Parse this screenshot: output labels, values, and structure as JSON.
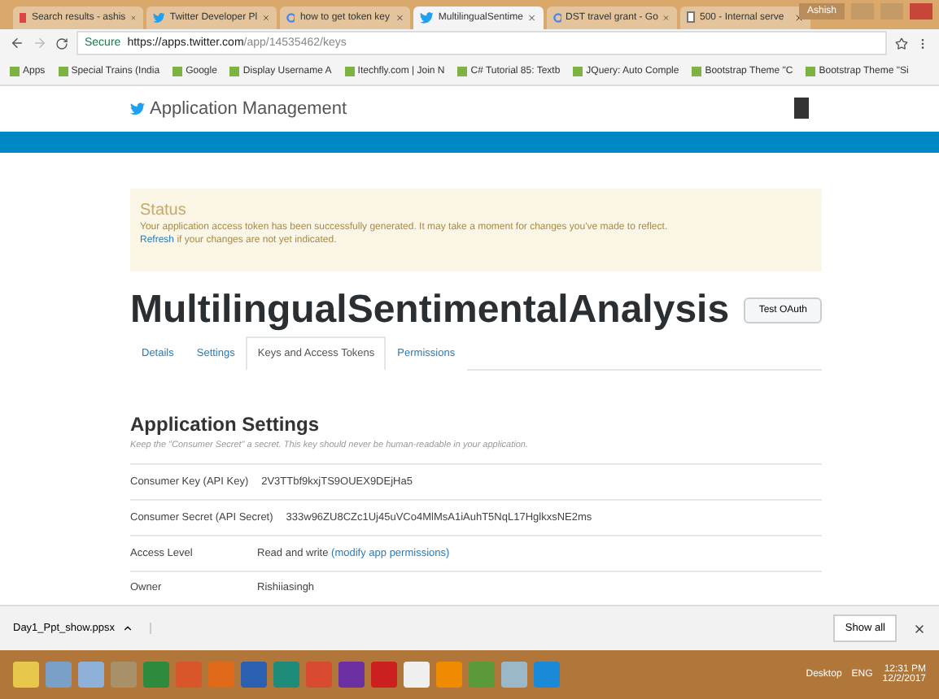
{
  "browser": {
    "tabs": [
      {
        "title": "Search results - ashis",
        "kind": "mail",
        "selected": false
      },
      {
        "title": "Twitter Developer Pl",
        "kind": "bird",
        "selected": false
      },
      {
        "title": "how to get token key",
        "kind": "search",
        "selected": false
      },
      {
        "title": "MultilingualSentime",
        "kind": "bird",
        "selected": true
      },
      {
        "title": "DST travel grant - Go",
        "kind": "search",
        "selected": false
      },
      {
        "title": "500 - Internal serve",
        "kind": "page",
        "selected": false
      }
    ],
    "user": "Ashish",
    "address": {
      "secure_label": "Secure",
      "host": "https://apps.twitter.com",
      "path": "/app/14535462/keys"
    },
    "bookmarks": [
      "Apps",
      "Special Trains (India",
      "Google",
      "Display Username A",
      "Itechfly.com | Join N",
      "C# Tutorial 85: Textb",
      "JQuery: Auto Comple",
      "Bootstrap Theme \"C",
      "Bootstrap Theme \"Si"
    ]
  },
  "header": {
    "title": "Application Management"
  },
  "status": {
    "heading": "Status",
    "message": "Your application access token has been successfully generated. It may take a moment for changes you've made to reflect.",
    "refresh_link": "Refresh",
    "refresh_rest": "if your changes are not yet indicated."
  },
  "app": {
    "name": "MultilingualSentimentalAnalysis",
    "test_button": "Test OAuth",
    "nav": [
      {
        "label": "Details",
        "selected": false
      },
      {
        "label": "Settings",
        "selected": false
      },
      {
        "label": "Keys and Access Tokens",
        "selected": true
      },
      {
        "label": "Permissions",
        "selected": false
      }
    ]
  },
  "settings": {
    "heading": "Application Settings",
    "note": "Keep the \"Consumer Secret\" a secret. This key should never be human-readable in your application.",
    "rows": [
      {
        "label": "Consumer Key (API Key)",
        "value": "2V3TTbf9kxjTS9OUEX9DEjHa5"
      },
      {
        "label": "Consumer Secret (API Secret)",
        "value": "333w96ZU8CZc1Uj45uVCo4MlMsA1iAuhT5NqL17HglkxsNE2ms"
      },
      {
        "label": "Access Level",
        "value": "Read and write",
        "link": "(modify app permissions)"
      },
      {
        "label": "Owner",
        "value": "Rishiiasingh"
      }
    ]
  },
  "downloads": {
    "file": "Day1_Ppt_show.ppsx",
    "show_all": "Show all"
  },
  "taskbar": {
    "apps": [
      {
        "color": "#e8c84a"
      },
      {
        "color": "#7aa0c8"
      },
      {
        "color": "#8fb0d8"
      },
      {
        "color": "#a89068"
      },
      {
        "color": "#2e8b3e"
      },
      {
        "color": "#d8562a"
      },
      {
        "color": "#e06a1a"
      },
      {
        "color": "#2b5fb0"
      },
      {
        "color": "#1f8c7a"
      },
      {
        "color": "#d84a32"
      },
      {
        "color": "#6a2fa0"
      },
      {
        "color": "#cc1f1f"
      },
      {
        "color": "#f0f0f0"
      },
      {
        "color": "#f08a00"
      },
      {
        "color": "#5a9a3a"
      },
      {
        "color": "#9ab8c8"
      },
      {
        "color": "#1a8ad8"
      }
    ],
    "desktop": "Desktop",
    "lang": "ENG",
    "time": "12:31 PM",
    "date": "12/2/2017"
  }
}
